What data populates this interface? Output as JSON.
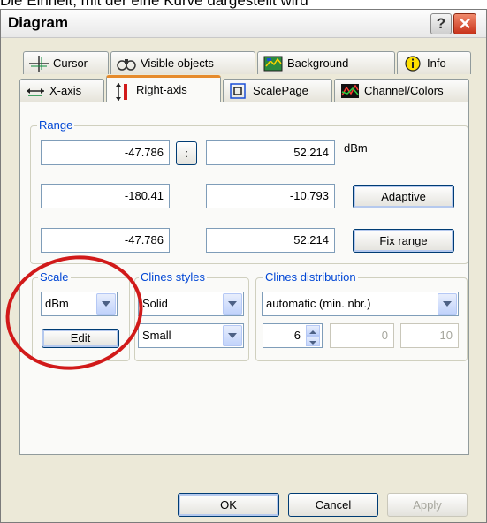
{
  "background_text": "Die Einheit, mit der eine Kurve dargestellt wird",
  "dialog": {
    "title": "Diagram",
    "help_label": "?",
    "close_label": "✕"
  },
  "tabs_row1": [
    {
      "label": "Cursor",
      "icon": "cursor-crosshair-icon"
    },
    {
      "label": "Visible objects",
      "icon": "binoculars-icon"
    },
    {
      "label": "Background",
      "icon": "background-map-icon"
    },
    {
      "label": "Info",
      "icon": "info-icon"
    }
  ],
  "tabs_row2": [
    {
      "label": "X-axis",
      "icon": "x-axis-icon"
    },
    {
      "label": "Right-axis",
      "icon": "right-axis-icon",
      "active": true
    },
    {
      "label": "ScalePage",
      "icon": "scalepage-icon"
    },
    {
      "label": "Channel/Colors",
      "icon": "channel-colors-icon"
    }
  ],
  "range": {
    "legend": "Range",
    "row1": {
      "min": "-47.786",
      "max": "52.214",
      "unit": "dBm",
      "sep_label": ":"
    },
    "row2": {
      "min": "-180.41",
      "max": "-10.793",
      "button": "Adaptive"
    },
    "row3": {
      "min": "-47.786",
      "max": "52.214",
      "button": "Fix range"
    }
  },
  "scale": {
    "legend": "Scale",
    "unit_value": "dBm",
    "edit_label": "Edit"
  },
  "clines_styles": {
    "legend": "Clines styles",
    "style_value": "Solid",
    "width_value": "Small"
  },
  "clines_distribution": {
    "legend": "Clines distribution",
    "mode_value": "automatic (min. nbr.)",
    "count_value": "6",
    "min_value": "0",
    "max_value": "10"
  },
  "footer": {
    "ok": "OK",
    "cancel": "Cancel",
    "apply": "Apply"
  },
  "colors": {
    "accent": "#0046d5",
    "annotation_ring": "#d11a1a",
    "active_tab": "#e68b2c"
  }
}
